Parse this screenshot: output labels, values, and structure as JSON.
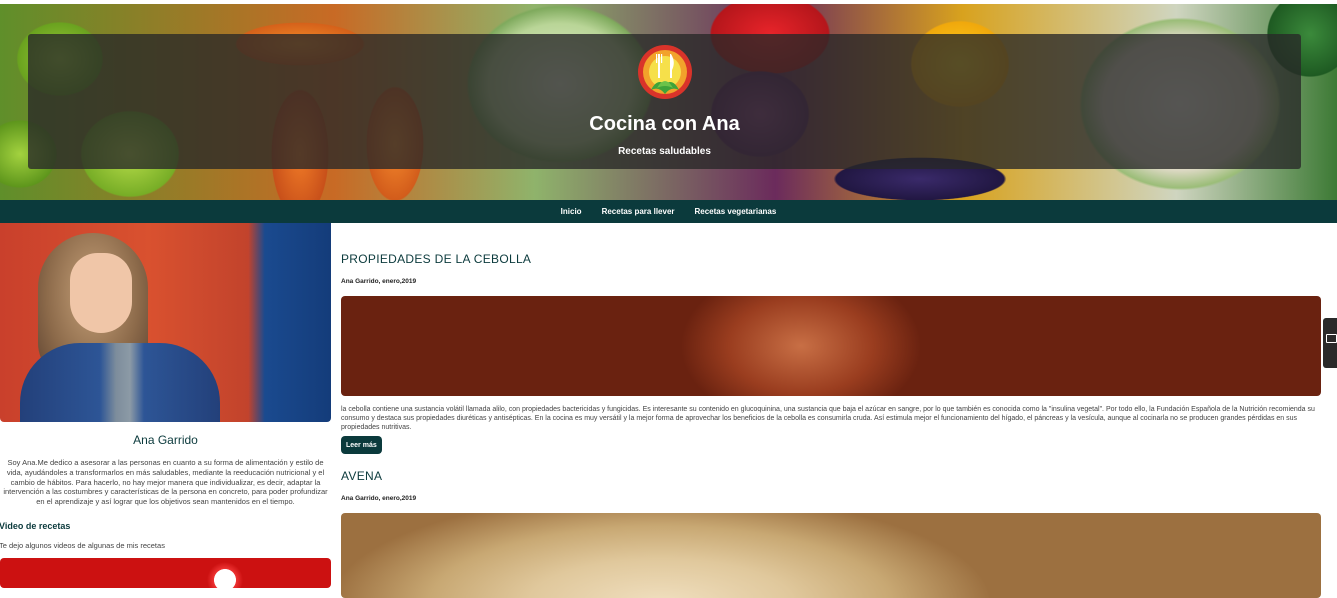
{
  "header": {
    "title": "Cocina con Ana",
    "subtitle": "Recetas saludables",
    "logo_icon": "fork-knife-plate-logo"
  },
  "nav": {
    "items": [
      "Inicio",
      "Recetas para llever",
      "Recetas vegetarianas"
    ]
  },
  "sidebar": {
    "name": "Ana Garrido",
    "bio": "Soy Ana.Me dedico a asesorar a las personas en cuanto a su forma de alimentación y estilo de vida, ayudándoles a transformarlos en más saludables, mediante la reeducación nutricional y el cambio de hábitos. Para hacerlo, no hay mejor manera que individualizar, es decir, adaptar la intervención a las costumbres y características de la persona en concreto, para poder profundizar en el aprendizaje y así lograr que los objetivos sean mantenidos en el tiempo.",
    "video_heading": "Video de recetas",
    "video_text": "Te dejo algunos videos de algunas de mis recetas"
  },
  "posts": [
    {
      "title": "PROPIEDADES DE LA CEBOLLA",
      "meta": "Ana Garrido, enero,2019",
      "body": "la cebolla contiene una sustancia volátil llamada alilo, con propiedades bactericidas y fungicidas. Es interesante su contenido en glucoquinina, una sustancia que baja el azúcar en sangre, por lo que también es conocida como la \"insulina vegetal\". Por todo ello, la Fundación Española de la Nutrición recomienda su consumo y destaca sus propiedades diuréticas y antisépticas. En la cocina es muy versátil y la mejor forma de aprovechar los beneficios de la cebolla es consumirla cruda. Así estimula mejor el funcionamiento del hígado, el páncreas y la vesícula, aunque al cocinarla no se producen grandes pérdidas en sus propiedades nutritivas.",
      "button": "Leer más"
    },
    {
      "title": "AVENA",
      "meta": "Ana Garrido, enero,2019"
    }
  ],
  "colors": {
    "nav_bg": "#0b3a3c",
    "accent": "#0b3a3c",
    "panel": "rgba(40,40,40,0.78)"
  }
}
